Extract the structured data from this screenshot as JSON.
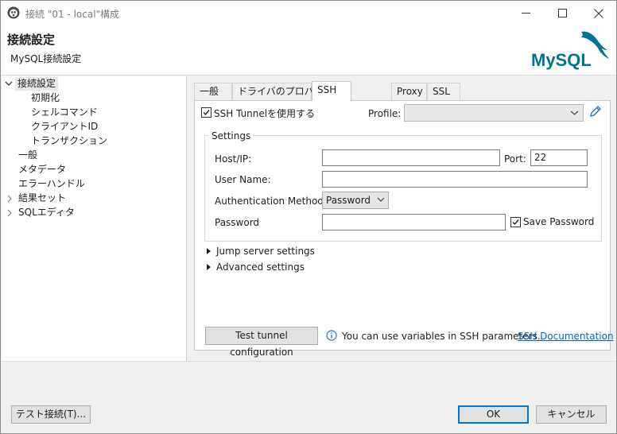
{
  "window": {
    "title": "接続 \"01 - local\"構成"
  },
  "header": {
    "title": "接続設定",
    "subtitle": "MySQL接続設定",
    "logo_text": "MySQL"
  },
  "tree": {
    "items": [
      {
        "label": "接続設定",
        "level": 0,
        "expanded": true,
        "selected": true
      },
      {
        "label": "初期化",
        "level": 1
      },
      {
        "label": "シェルコマンド",
        "level": 1
      },
      {
        "label": "クライアントID",
        "level": 1
      },
      {
        "label": "トランザクション",
        "level": 1
      },
      {
        "label": "一般",
        "level": 0
      },
      {
        "label": "メタデータ",
        "level": 0
      },
      {
        "label": "エラーハンドル",
        "level": 0
      },
      {
        "label": "結果セット",
        "level": 0,
        "collapsed": true
      },
      {
        "label": "SQLエディタ",
        "level": 0,
        "collapsed": true
      }
    ]
  },
  "tabs": [
    {
      "label": "一般"
    },
    {
      "label": "ドライバのプロパティ"
    },
    {
      "label": "SSH",
      "active": true
    },
    {
      "label": "Proxy"
    },
    {
      "label": "SSL"
    }
  ],
  "ssh": {
    "use_tunnel_label": "SSH Tunnelを使用する",
    "use_tunnel_checked": true,
    "profile_label": "Profile:",
    "profile_value": "",
    "settings_legend": "Settings",
    "host_label": "Host/IP:",
    "host_value": "",
    "port_label": "Port:",
    "port_value": "22",
    "user_label": "User Name:",
    "user_value": "",
    "auth_label": "Authentication Method:",
    "auth_value": "Password",
    "password_label": "Password",
    "password_value": "",
    "save_password_label": "Save Password",
    "save_password_checked": true,
    "jump_server_label": "Jump server settings",
    "advanced_label": "Advanced settings",
    "test_button": "Test tunnel configuration",
    "info_text": "You can use variables in SSH parameters.",
    "doc_link": "SSH Documentation"
  },
  "footer": {
    "test_connection": "テスト接続(T)...",
    "ok": "OK",
    "cancel": "キャンセル"
  },
  "colors": {
    "accent": "#0078d7",
    "link": "#0066cc",
    "mysql_blue": "#00758f",
    "mysql_orange": "#f29111"
  }
}
